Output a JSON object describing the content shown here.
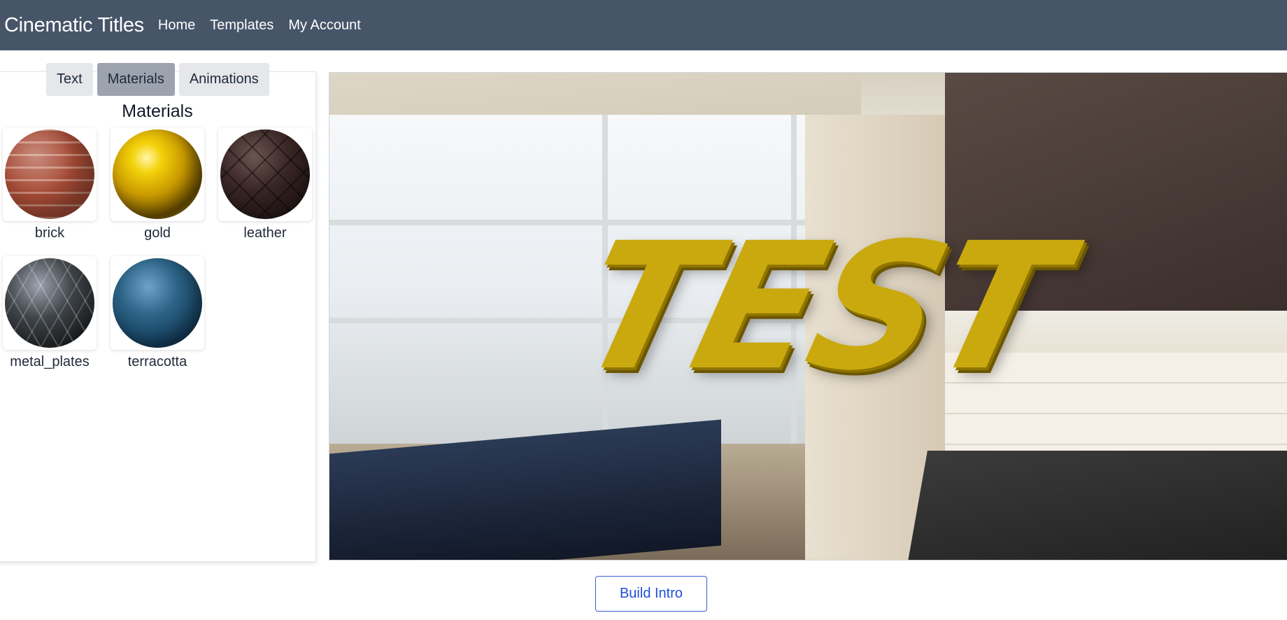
{
  "navbar": {
    "brand": "Cinematic Titles",
    "links": [
      "Home",
      "Templates",
      "My Account"
    ],
    "background": "#475569"
  },
  "panel": {
    "tabs": [
      {
        "label": "Text",
        "active": false
      },
      {
        "label": "Materials",
        "active": true
      },
      {
        "label": "Animations",
        "active": false
      }
    ],
    "title": "Materials",
    "materials": [
      {
        "label": "brick"
      },
      {
        "label": "gold"
      },
      {
        "label": "leather"
      },
      {
        "label": "metal_plates"
      },
      {
        "label": "terracotta"
      }
    ]
  },
  "preview": {
    "title_text": "TEST",
    "material": "gold"
  },
  "actions": {
    "build_label": "Build Intro",
    "accent": "#1d4ed8"
  }
}
